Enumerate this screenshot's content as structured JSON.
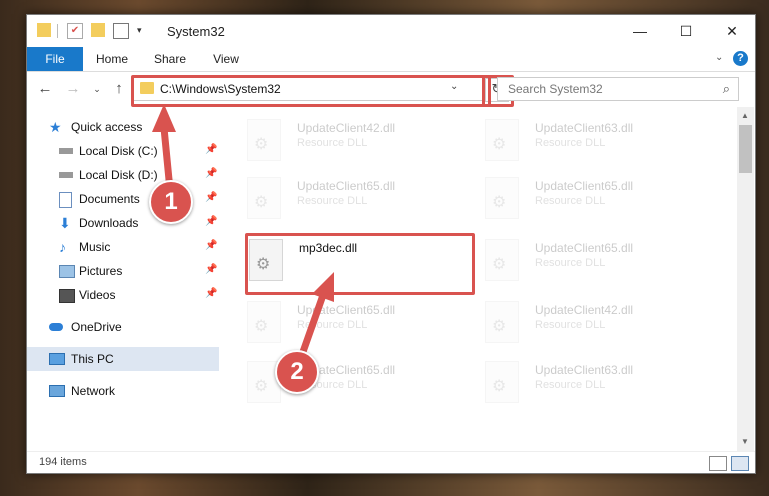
{
  "window": {
    "title": "System32"
  },
  "ribbon": {
    "tabs": [
      "File",
      "Home",
      "Share",
      "View"
    ],
    "help_glyph": "?"
  },
  "nav": {
    "address": "C:\\Windows\\System32",
    "search_placeholder": "Search System32"
  },
  "sidebar": {
    "items": [
      {
        "label": "Quick access",
        "icon": "star-icon",
        "pinned": false
      },
      {
        "label": "Local Disk (C:)",
        "icon": "drive-icon",
        "pinned": true
      },
      {
        "label": "Local Disk (D:)",
        "icon": "drive-icon",
        "pinned": true
      },
      {
        "label": "Documents",
        "icon": "documents-icon",
        "pinned": true
      },
      {
        "label": "Downloads",
        "icon": "downloads-icon",
        "pinned": true
      },
      {
        "label": "Music",
        "icon": "music-icon",
        "pinned": true
      },
      {
        "label": "Pictures",
        "icon": "pictures-icon",
        "pinned": true
      },
      {
        "label": "Videos",
        "icon": "videos-icon",
        "pinned": true
      },
      {
        "label": "OneDrive",
        "icon": "onedrive-icon",
        "pinned": false
      },
      {
        "label": "This PC",
        "icon": "this-pc-icon",
        "pinned": false,
        "selected": true
      },
      {
        "label": "Network",
        "icon": "network-icon",
        "pinned": false
      }
    ]
  },
  "files": [
    {
      "name": "UpdateClient42.dll",
      "type": "Resource DLL",
      "faded": true
    },
    {
      "name": "UpdateClient63.dll",
      "type": "Resource DLL",
      "faded": true
    },
    {
      "name": "UpdateClient65.dll",
      "type": "Resource DLL",
      "faded": true
    },
    {
      "name": "UpdateClient65.dll",
      "type": "Resource DLL",
      "faded": true
    },
    {
      "name": "mp3dec.dll",
      "type": "",
      "faded": false
    },
    {
      "name": "UpdateClient65.dll",
      "type": "Resource DLL",
      "faded": true
    },
    {
      "name": "UpdateClient65.dll",
      "type": "Resource DLL",
      "faded": true
    },
    {
      "name": "UpdateClient42.dll",
      "type": "Resource DLL",
      "faded": true
    },
    {
      "name": "UpdateClient65.dll",
      "type": "Resource DLL",
      "faded": true
    },
    {
      "name": "UpdateClient63.dll",
      "type": "Resource DLL",
      "faded": true
    }
  ],
  "status": {
    "item_count": "194 items"
  },
  "callouts": [
    "1",
    "2"
  ],
  "colors": {
    "accent": "#1979ca",
    "highlight": "#d9534f",
    "selected": "#dde6f2"
  }
}
